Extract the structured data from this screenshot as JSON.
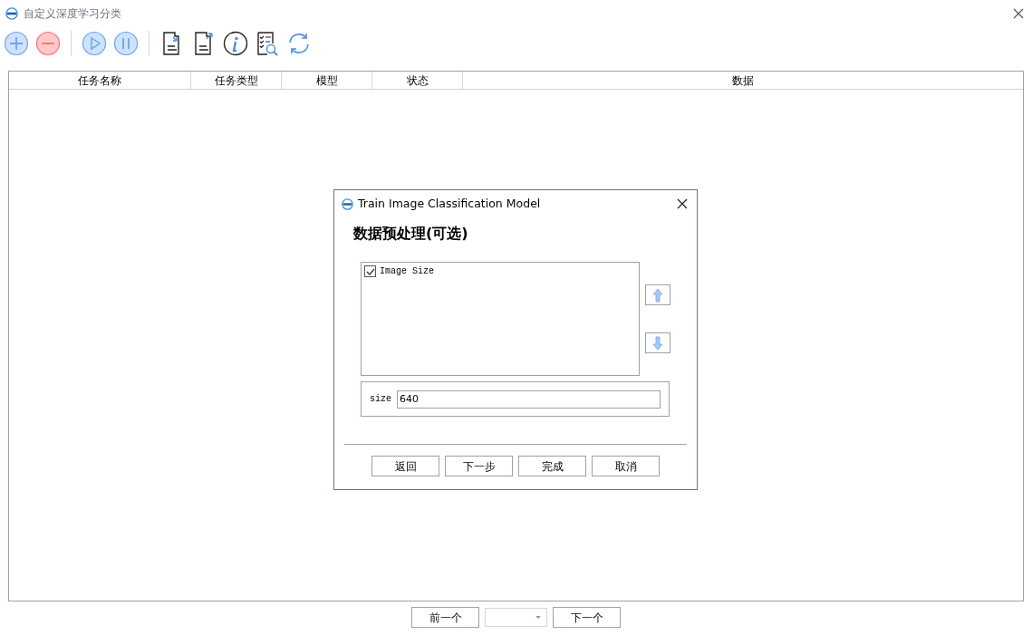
{
  "window": {
    "title": "自定义深度学习分类"
  },
  "toolbar": {
    "buttons": [
      {
        "kind": "add",
        "disabled": false
      },
      {
        "kind": "remove",
        "disabled": false
      },
      {
        "kind": "sep"
      },
      {
        "kind": "play",
        "disabled": false
      },
      {
        "kind": "pause",
        "disabled": false
      },
      {
        "kind": "sep"
      },
      {
        "kind": "import"
      },
      {
        "kind": "export"
      },
      {
        "kind": "info"
      },
      {
        "kind": "checklist"
      },
      {
        "kind": "refresh"
      }
    ]
  },
  "table": {
    "columns": [
      "任务名称",
      "任务类型",
      "模型",
      "状态",
      "数据"
    ]
  },
  "dialog": {
    "title": "Train Image Classification Model",
    "heading": "数据预处理(可选)",
    "items": [
      {
        "label": "Image Size",
        "checked": true
      }
    ],
    "param": {
      "label": "size",
      "value": "640"
    },
    "buttons": [
      "返回",
      "下一步",
      "完成",
      "取消"
    ]
  },
  "pager": {
    "prev": "前一个",
    "next": "下一个"
  }
}
